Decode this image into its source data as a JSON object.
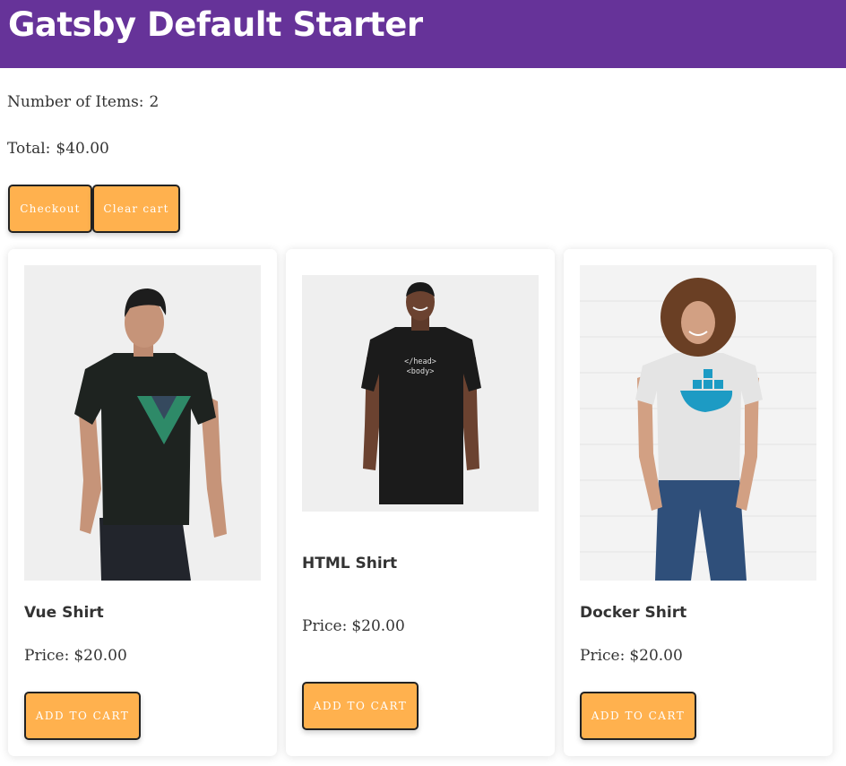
{
  "header": {
    "title": "Gatsby Default Starter"
  },
  "cart": {
    "items_label": "Number of Items:",
    "items_count": "2",
    "total_label": "Total:",
    "total_value": "$40.00",
    "checkout_label": "Checkout",
    "clear_label": "Clear cart"
  },
  "products": [
    {
      "name": "Vue Shirt",
      "price_label": "Price:",
      "price": "$20.00",
      "button_label": "ADD TO CART",
      "image": "man-in-black-vue-logo-tshirt"
    },
    {
      "name": "HTML Shirt",
      "price_label": "Price:",
      "price": "$20.00",
      "button_label": "ADD TO CART",
      "image": "man-in-black-html-tshirt",
      "shirt_text": [
        "</head>",
        "<body>"
      ]
    },
    {
      "name": "Docker Shirt",
      "price_label": "Price:",
      "price": "$20.00",
      "button_label": "ADD TO CART",
      "image": "woman-in-white-docker-tshirt"
    }
  ],
  "colors": {
    "header_bg": "#663399",
    "button_bg": "#ffb14e",
    "button_border": "#222222",
    "button_text": "#ffffff"
  }
}
